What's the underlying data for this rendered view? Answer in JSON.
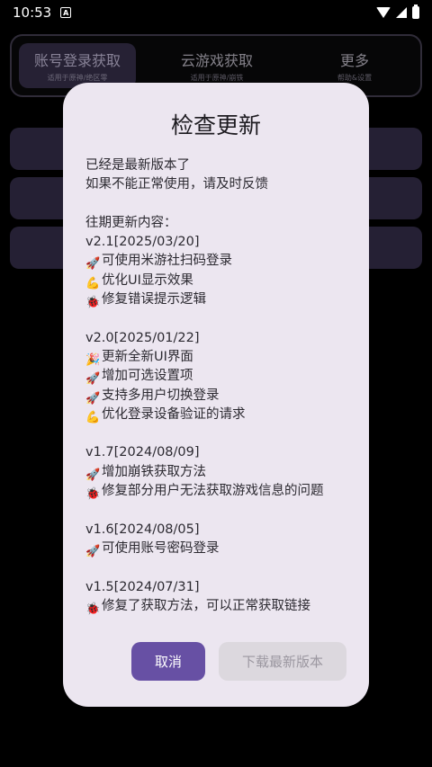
{
  "status_bar": {
    "time": "10:53",
    "notification_icon": "A"
  },
  "tabs": [
    {
      "title": "账号登录获取",
      "subtitle": "适用于原神/绝区零"
    },
    {
      "title": "云游戏获取",
      "subtitle": "适用于原神/崩铁"
    },
    {
      "title": "更多",
      "subtitle": "帮助&设置"
    }
  ],
  "dialog": {
    "title": "检查更新",
    "lines": [
      {
        "icon": "",
        "text": "已经是最新版本了"
      },
      {
        "icon": "",
        "text": "如果不能正常使用，请及时反馈"
      },
      {
        "icon": "",
        "text": ""
      },
      {
        "icon": "",
        "text": "往期更新内容："
      },
      {
        "icon": "",
        "text": "v2.1[2025/03/20]"
      },
      {
        "icon": "🚀",
        "text": "可使用米游社扫码登录"
      },
      {
        "icon": "💪",
        "text": "优化UI显示效果"
      },
      {
        "icon": "🐞",
        "text": "修复错误提示逻辑"
      },
      {
        "icon": "",
        "text": ""
      },
      {
        "icon": "",
        "text": "v2.0[2025/01/22]"
      },
      {
        "icon": "🎉",
        "text": "更新全新UI界面"
      },
      {
        "icon": "🚀",
        "text": "增加可选设置项"
      },
      {
        "icon": "🚀",
        "text": "支持多用户切换登录"
      },
      {
        "icon": "💪",
        "text": "优化登录设备验证的请求"
      },
      {
        "icon": "",
        "text": ""
      },
      {
        "icon": "",
        "text": "v1.7[2024/08/09]"
      },
      {
        "icon": "🚀",
        "text": "增加崩铁获取方法"
      },
      {
        "icon": "🐞",
        "text": "修复部分用户无法获取游戏信息的问题"
      },
      {
        "icon": "",
        "text": ""
      },
      {
        "icon": "",
        "text": "v1.6[2024/08/05]"
      },
      {
        "icon": "🚀",
        "text": "可使用账号密码登录"
      },
      {
        "icon": "",
        "text": ""
      },
      {
        "icon": "",
        "text": "v1.5[2024/07/31]"
      },
      {
        "icon": "🐞",
        "text": "修复了获取方法，可以正常获取链接"
      }
    ],
    "cancel_label": "取消",
    "download_label": "下载最新版本"
  },
  "colors": {
    "primary": "#6750a4",
    "dialog_bg": "#ece6f0",
    "button_disabled": "#dcd8de"
  }
}
